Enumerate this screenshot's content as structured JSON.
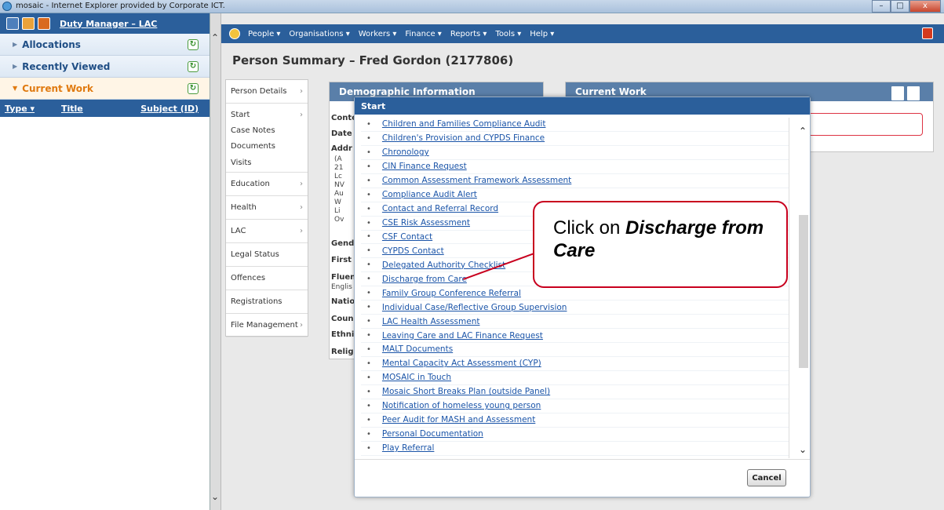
{
  "window": {
    "title": "mosaic - Internet Explorer provided by Corporate ICT.",
    "controls": [
      "–",
      "□",
      "x"
    ]
  },
  "left_panel": {
    "user_link": "Duty Manager – LAC",
    "sections": [
      {
        "label": "Allocations",
        "open": false
      },
      {
        "label": "Recently Viewed",
        "open": false
      },
      {
        "label": "Current Work",
        "open": true
      }
    ],
    "current_work_columns": [
      "Type ▾",
      "Title",
      "Subject (ID)"
    ]
  },
  "menu": {
    "items": [
      "People ▾",
      "Organisations ▾",
      "Workers ▾",
      "Finance ▾",
      "Reports ▾",
      "Tools ▾",
      "Help ▾"
    ]
  },
  "page": {
    "title": "Person Summary – Fred Gordon (2177806)"
  },
  "sidenav": {
    "items": [
      {
        "label": "Person Details",
        "chevron": true
      },
      {
        "label": "Start",
        "chevron": true,
        "sub": true
      },
      {
        "label": "Case Notes",
        "chevron": false,
        "sub": true
      },
      {
        "label": "Documents",
        "chevron": false,
        "sub": true
      },
      {
        "label": "Visits",
        "chevron": false,
        "sub": true
      },
      {
        "label": "Education",
        "chevron": true
      },
      {
        "label": "Health",
        "chevron": true
      },
      {
        "label": "LAC",
        "chevron": true
      },
      {
        "label": "Legal Status",
        "chevron": false
      },
      {
        "label": "Offences",
        "chevron": false
      },
      {
        "label": "Registrations",
        "chevron": false
      },
      {
        "label": "File Management",
        "chevron": true
      }
    ]
  },
  "demographics": {
    "header": "Demographic Information",
    "labels": [
      "Conte",
      "Date",
      "Addr",
      "Gend",
      "First",
      "Fluen",
      "Natio",
      "Coun",
      "Ethni",
      "Religi"
    ],
    "address_lines": [
      "(A",
      "21",
      "Lc",
      "NV",
      "Au",
      "W",
      "Li",
      "Ov"
    ],
    "fluent_value": "Englis"
  },
  "current_work_card": {
    "header": "Current Work"
  },
  "dialog": {
    "title": "Start",
    "items": [
      "Children and Families Compliance Audit",
      "Children's Provision and CYPDS Finance",
      "Chronology",
      "CIN Finance Request",
      "Common Assessment Framework Assessment",
      "Compliance Audit Alert",
      "Contact and Referral Record",
      "CSE Risk Assessment",
      "CSF Contact",
      "CYPDS Contact",
      "Delegated Authority Checklist",
      "Discharge from Care",
      "Family Group Conference Referral",
      "Individual Case/Reflective Group Supervision",
      "LAC Health Assessment",
      "Leaving Care and LAC Finance Request",
      "MALT Documents",
      "Mental Capacity Act Assessment (CYP)",
      "MOSAIC in Touch",
      "Mosaic Short Breaks Plan (outside Panel)",
      "Notification of homeless young person",
      "Peer Audit for MASH and Assessment",
      "Personal Documentation",
      "Play Referral"
    ],
    "cancel_label": "Cancel"
  },
  "callout": {
    "prefix": "Click on ",
    "emphasis": "Discharge from Care"
  }
}
